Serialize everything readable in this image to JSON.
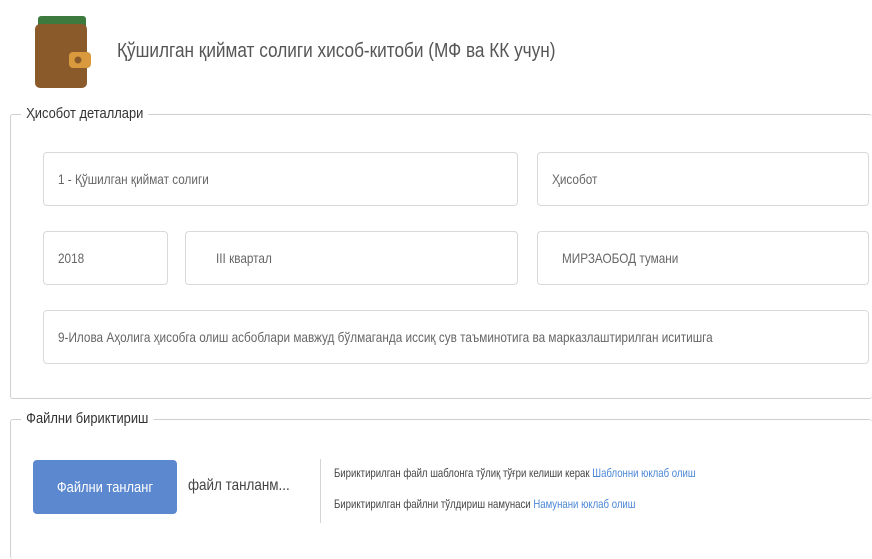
{
  "header": {
    "title": "Қўшилган қиймат солиги хисоб-китоби (МФ ва КК учун)",
    "icon": "wallet-icon"
  },
  "details": {
    "legend": "Ҳисобот деталлари",
    "tax_type": "1 - Қўшилган қиймат солиги",
    "report_type": "Ҳисобот",
    "year": "2018",
    "quarter": "III квартал",
    "district": "МИРЗАОБОД тумани",
    "appendix": "9-Илова Аҳолига ҳисобга олиш асбоблари мавжуд бўлмаганда иссиқ сув таъминотига ва марказлаштирилган иситишга"
  },
  "attach": {
    "legend": "Файлни бириктириш",
    "choose_button": "Файлни танланг",
    "file_status": "файл танланм...",
    "info1_text": "Бириктирилган файл шаблонга тўлиқ тўғри келиши керак",
    "info1_link": "Шаблонни юклаб олиш",
    "info2_text": "Бириктирилган файлни тўлдириш намунаси",
    "info2_link": "Намунани юклаб олиш"
  },
  "colors": {
    "accent_button": "#5b88cf",
    "link": "#4a86d6",
    "wallet_body": "#8b5a2b",
    "wallet_flap": "#3c7a3e",
    "wallet_clasp": "#e8a33c"
  }
}
